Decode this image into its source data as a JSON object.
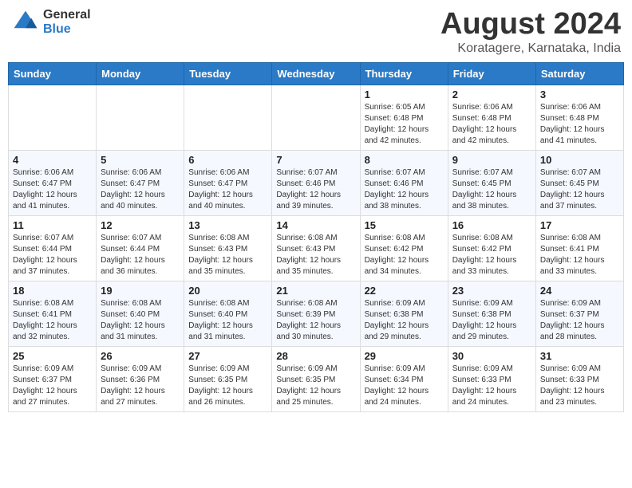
{
  "header": {
    "logo_line1": "General",
    "logo_line2": "Blue",
    "title": "August 2024",
    "subtitle": "Koratagere, Karnataka, India"
  },
  "calendar": {
    "days_of_week": [
      "Sunday",
      "Monday",
      "Tuesday",
      "Wednesday",
      "Thursday",
      "Friday",
      "Saturday"
    ],
    "weeks": [
      [
        {
          "day": "",
          "info": ""
        },
        {
          "day": "",
          "info": ""
        },
        {
          "day": "",
          "info": ""
        },
        {
          "day": "",
          "info": ""
        },
        {
          "day": "1",
          "info": "Sunrise: 6:05 AM\nSunset: 6:48 PM\nDaylight: 12 hours\nand 42 minutes."
        },
        {
          "day": "2",
          "info": "Sunrise: 6:06 AM\nSunset: 6:48 PM\nDaylight: 12 hours\nand 42 minutes."
        },
        {
          "day": "3",
          "info": "Sunrise: 6:06 AM\nSunset: 6:48 PM\nDaylight: 12 hours\nand 41 minutes."
        }
      ],
      [
        {
          "day": "4",
          "info": "Sunrise: 6:06 AM\nSunset: 6:47 PM\nDaylight: 12 hours\nand 41 minutes."
        },
        {
          "day": "5",
          "info": "Sunrise: 6:06 AM\nSunset: 6:47 PM\nDaylight: 12 hours\nand 40 minutes."
        },
        {
          "day": "6",
          "info": "Sunrise: 6:06 AM\nSunset: 6:47 PM\nDaylight: 12 hours\nand 40 minutes."
        },
        {
          "day": "7",
          "info": "Sunrise: 6:07 AM\nSunset: 6:46 PM\nDaylight: 12 hours\nand 39 minutes."
        },
        {
          "day": "8",
          "info": "Sunrise: 6:07 AM\nSunset: 6:46 PM\nDaylight: 12 hours\nand 38 minutes."
        },
        {
          "day": "9",
          "info": "Sunrise: 6:07 AM\nSunset: 6:45 PM\nDaylight: 12 hours\nand 38 minutes."
        },
        {
          "day": "10",
          "info": "Sunrise: 6:07 AM\nSunset: 6:45 PM\nDaylight: 12 hours\nand 37 minutes."
        }
      ],
      [
        {
          "day": "11",
          "info": "Sunrise: 6:07 AM\nSunset: 6:44 PM\nDaylight: 12 hours\nand 37 minutes."
        },
        {
          "day": "12",
          "info": "Sunrise: 6:07 AM\nSunset: 6:44 PM\nDaylight: 12 hours\nand 36 minutes."
        },
        {
          "day": "13",
          "info": "Sunrise: 6:08 AM\nSunset: 6:43 PM\nDaylight: 12 hours\nand 35 minutes."
        },
        {
          "day": "14",
          "info": "Sunrise: 6:08 AM\nSunset: 6:43 PM\nDaylight: 12 hours\nand 35 minutes."
        },
        {
          "day": "15",
          "info": "Sunrise: 6:08 AM\nSunset: 6:42 PM\nDaylight: 12 hours\nand 34 minutes."
        },
        {
          "day": "16",
          "info": "Sunrise: 6:08 AM\nSunset: 6:42 PM\nDaylight: 12 hours\nand 33 minutes."
        },
        {
          "day": "17",
          "info": "Sunrise: 6:08 AM\nSunset: 6:41 PM\nDaylight: 12 hours\nand 33 minutes."
        }
      ],
      [
        {
          "day": "18",
          "info": "Sunrise: 6:08 AM\nSunset: 6:41 PM\nDaylight: 12 hours\nand 32 minutes."
        },
        {
          "day": "19",
          "info": "Sunrise: 6:08 AM\nSunset: 6:40 PM\nDaylight: 12 hours\nand 31 minutes."
        },
        {
          "day": "20",
          "info": "Sunrise: 6:08 AM\nSunset: 6:40 PM\nDaylight: 12 hours\nand 31 minutes."
        },
        {
          "day": "21",
          "info": "Sunrise: 6:08 AM\nSunset: 6:39 PM\nDaylight: 12 hours\nand 30 minutes."
        },
        {
          "day": "22",
          "info": "Sunrise: 6:09 AM\nSunset: 6:38 PM\nDaylight: 12 hours\nand 29 minutes."
        },
        {
          "day": "23",
          "info": "Sunrise: 6:09 AM\nSunset: 6:38 PM\nDaylight: 12 hours\nand 29 minutes."
        },
        {
          "day": "24",
          "info": "Sunrise: 6:09 AM\nSunset: 6:37 PM\nDaylight: 12 hours\nand 28 minutes."
        }
      ],
      [
        {
          "day": "25",
          "info": "Sunrise: 6:09 AM\nSunset: 6:37 PM\nDaylight: 12 hours\nand 27 minutes."
        },
        {
          "day": "26",
          "info": "Sunrise: 6:09 AM\nSunset: 6:36 PM\nDaylight: 12 hours\nand 27 minutes."
        },
        {
          "day": "27",
          "info": "Sunrise: 6:09 AM\nSunset: 6:35 PM\nDaylight: 12 hours\nand 26 minutes."
        },
        {
          "day": "28",
          "info": "Sunrise: 6:09 AM\nSunset: 6:35 PM\nDaylight: 12 hours\nand 25 minutes."
        },
        {
          "day": "29",
          "info": "Sunrise: 6:09 AM\nSunset: 6:34 PM\nDaylight: 12 hours\nand 24 minutes."
        },
        {
          "day": "30",
          "info": "Sunrise: 6:09 AM\nSunset: 6:33 PM\nDaylight: 12 hours\nand 24 minutes."
        },
        {
          "day": "31",
          "info": "Sunrise: 6:09 AM\nSunset: 6:33 PM\nDaylight: 12 hours\nand 23 minutes."
        }
      ]
    ]
  }
}
